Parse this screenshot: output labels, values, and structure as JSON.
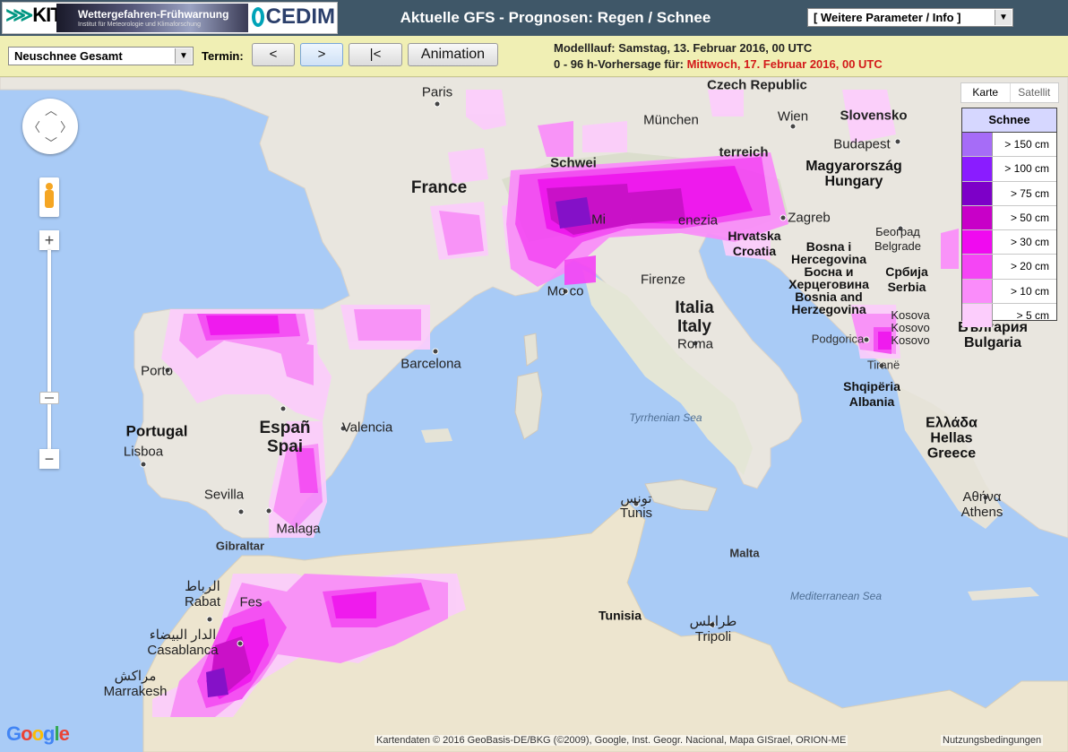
{
  "header": {
    "kit_logo": "KIT",
    "banner_title": "Wettergefahren-Frühwarnung",
    "banner_subtitle": "Institut für Meteorologie und Klimaforschung",
    "cedim_logo": "CEDIM",
    "title": "Aktuelle GFS - Prognosen: Regen / Schnee",
    "param_select": "[ Weitere Parameter / Info ]"
  },
  "controls": {
    "variable_select": "Neuschnee Gesamt",
    "termin_label": "Termin:",
    "prev": "<",
    "next": ">",
    "first": "|<",
    "animation": "Animation",
    "model_run": "Modelllauf: Samstag, 13. Februar 2016, 00 UTC",
    "forecast_prefix": "0 - 96 h-Vorhersage für: ",
    "forecast_date": "Mittwoch, 17. Februar 2016, 00 UTC"
  },
  "map_type": {
    "map": "Karte",
    "satellite": "Satellit"
  },
  "legend": {
    "title": "Schnee",
    "items": [
      {
        "label": "> 150 cm",
        "color": "#a66cf7"
      },
      {
        "label": "> 100 cm",
        "color": "#8a1cff"
      },
      {
        "label": "> 75 cm",
        "color": "#7d00c8"
      },
      {
        "label": "> 50 cm",
        "color": "#c800c8"
      },
      {
        "label": "> 30 cm",
        "color": "#f00af0"
      },
      {
        "label": "> 20 cm",
        "color": "#f545f5"
      },
      {
        "label": "> 10 cm",
        "color": "#fa8cfa"
      },
      {
        "label": "> 5 cm",
        "color": "#fccdfc"
      }
    ]
  },
  "labels": {
    "paris": "Paris",
    "czech": "Czech Republic",
    "munchen": "München",
    "wien": "Wien",
    "slovakia": "Slovensko",
    "france": "France",
    "schweiz": "Schwei",
    "osterreich": "terreich",
    "budapest": "Budapest",
    "hungary": "Magyarország\nHungary",
    "milano": "Mi",
    "venezia": "enezia",
    "zagreb": "Zagreb",
    "croatia": "Hrvatska\nCroatia",
    "bosnia": "Bosna i\nHercegovina\nБосна и\nХерцеговина\nBosnia and\nHerzegovina",
    "belgrade": "Београд\nBelgrade",
    "serbia": "Србија\nSerbia",
    "monaco": "Mo  co",
    "firenze": "Firenze",
    "italy": "Italia\nItaly",
    "roma": "Roma",
    "kosovo": "Kosova\nKosovo\nKosovo",
    "podgorica": "Podgorica",
    "bulgaria": "България\nBulgaria",
    "tirane": "Tiranë",
    "albania": "Shqipëria\nAlbania",
    "greece": "Ελλάδα\nHellas\nGreece",
    "athens": "Αθήνα\nAthens",
    "porto": "Porto",
    "barcelona": "Barcelona",
    "portugal": "Portugal",
    "lisboa": "Lisboa",
    "espana": "Españ\nSpai",
    "valencia": "Valencia",
    "sevilla": "Sevilla",
    "malaga": "Malaga",
    "gibraltar": "Gibraltar",
    "tyrrhenian": "Tyrrhenian Sea",
    "tunis": "تونس\nTunis",
    "malta": "Malta",
    "rabat": "الرباط\nRabat",
    "fes": "Fes",
    "casablanca": "الدار البيضاء\nCasablanca",
    "marrakesh": "مراكش\nMarrakesh",
    "tunisia": "Tunisia",
    "tripoli": "طرابلس\nTripoli",
    "mediterranean": "Mediterranean Sea"
  },
  "footer": {
    "google": "Google",
    "attribution": "Kartendaten © 2016 GeoBasis-DE/BKG (©2009), Google, Inst. Geogr. Nacional, Mapa GISrael, ORION-ME",
    "terms": "Nutzungsbedingungen"
  }
}
